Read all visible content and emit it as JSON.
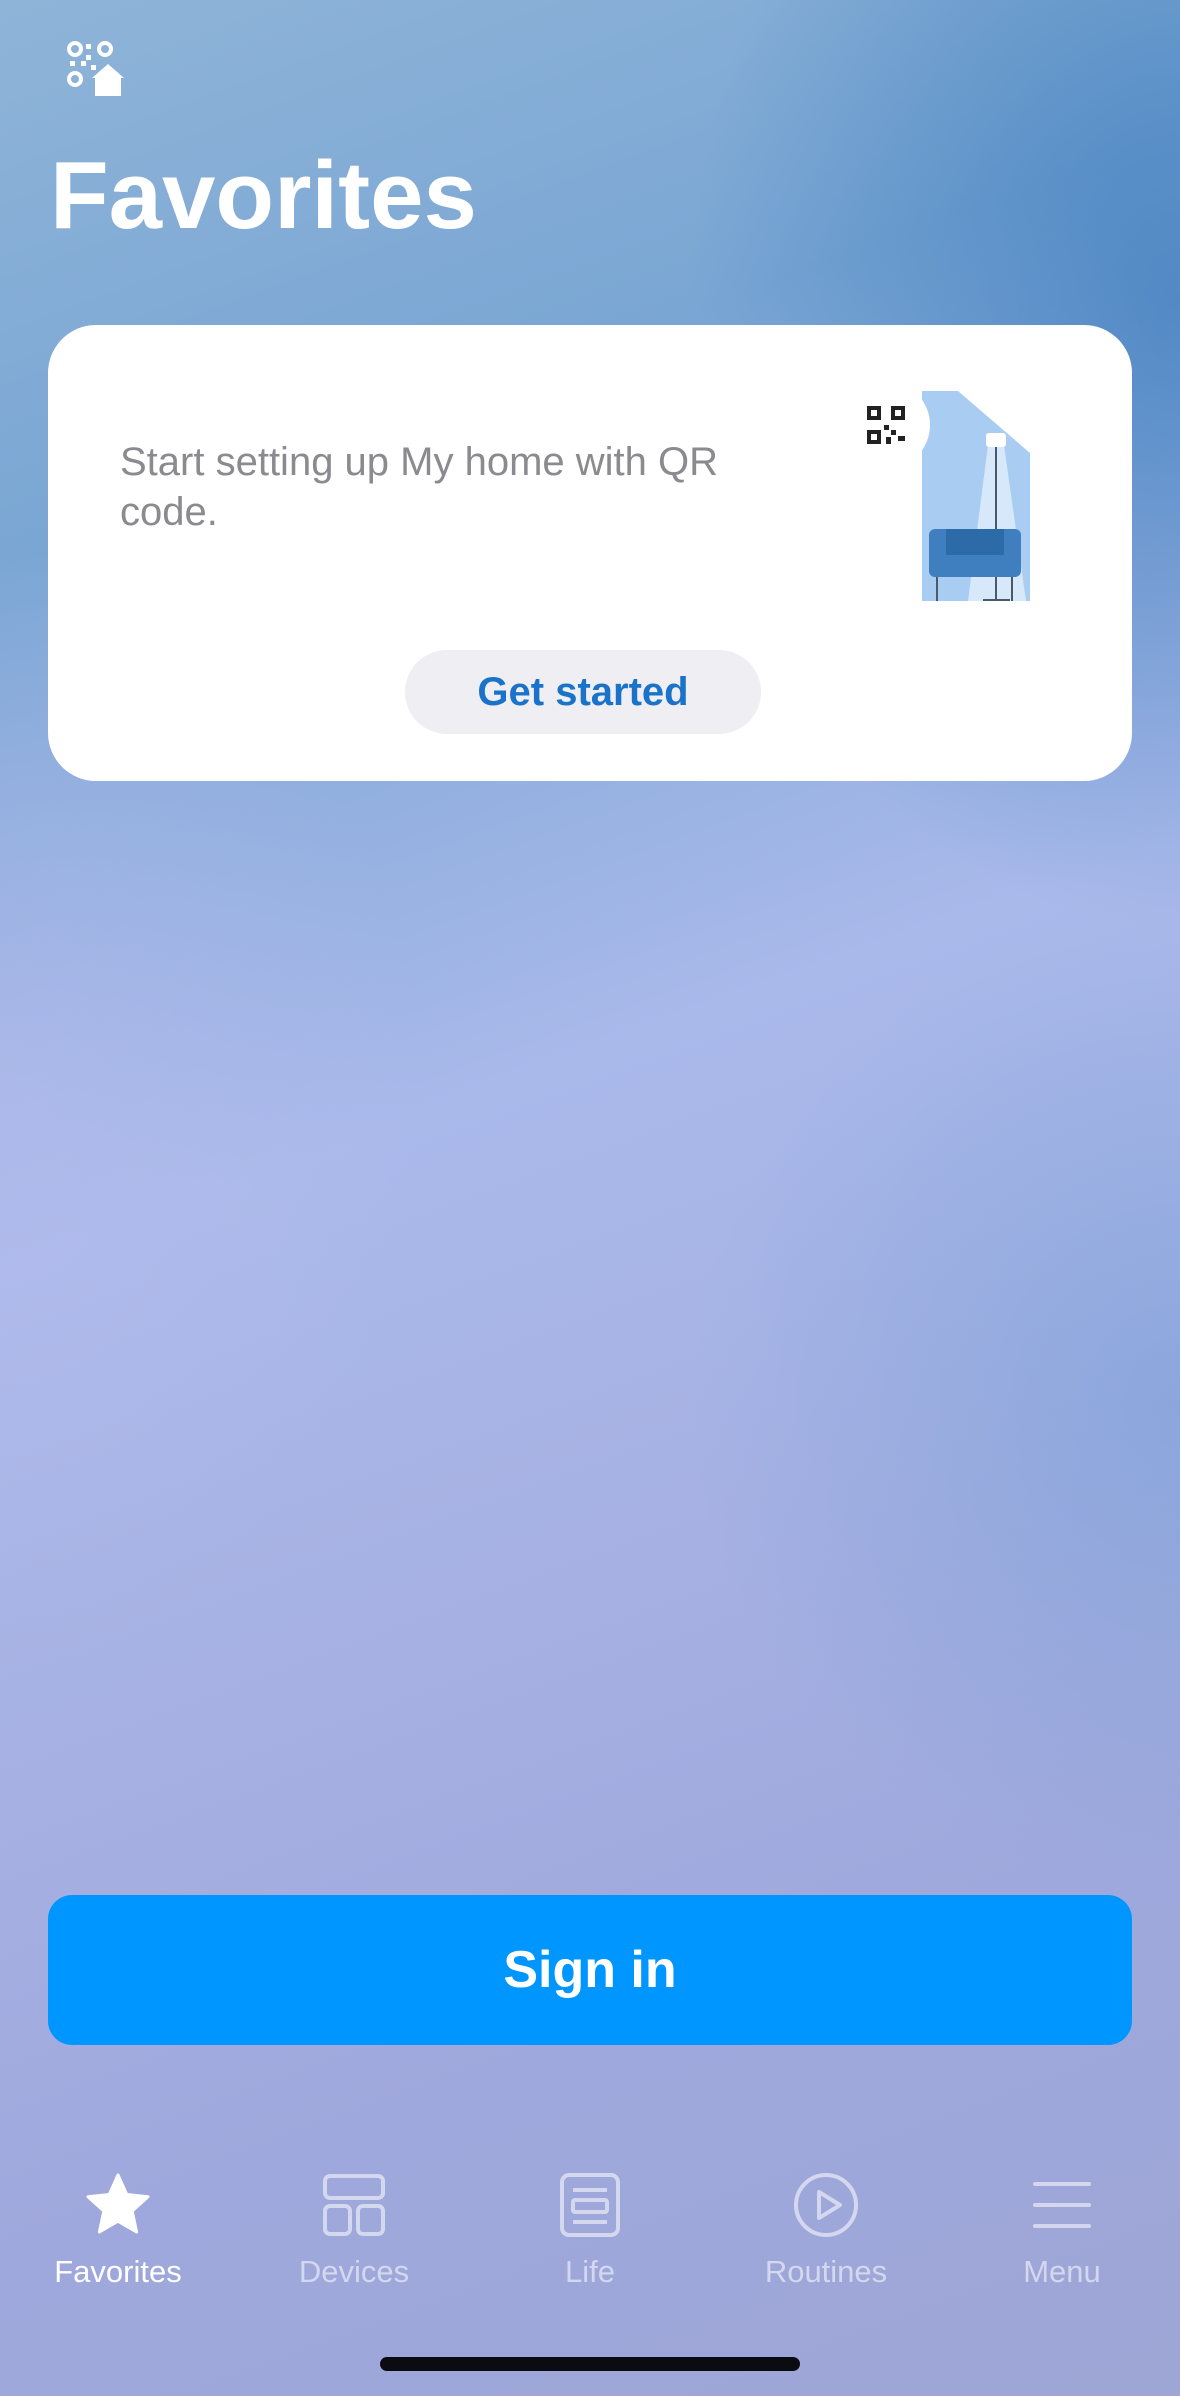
{
  "header": {
    "title": "Favorites",
    "qr_home_icon": "qr-home-icon"
  },
  "setup_card": {
    "message": "Start setting up My home with QR code.",
    "button_label": "Get started",
    "illustration": "qr-room-illustration"
  },
  "sign_in": {
    "label": "Sign in"
  },
  "tab_bar": {
    "items": [
      {
        "label": "Favorites",
        "icon": "star-icon",
        "active": true
      },
      {
        "label": "Devices",
        "icon": "devices-grid-icon",
        "active": false
      },
      {
        "label": "Life",
        "icon": "life-icon",
        "active": false
      },
      {
        "label": "Routines",
        "icon": "play-circle-icon",
        "active": false
      },
      {
        "label": "Menu",
        "icon": "menu-icon",
        "active": false
      }
    ]
  },
  "colors": {
    "accent": "#0096ff",
    "link": "#1a73c9",
    "card": "#ffffff"
  }
}
